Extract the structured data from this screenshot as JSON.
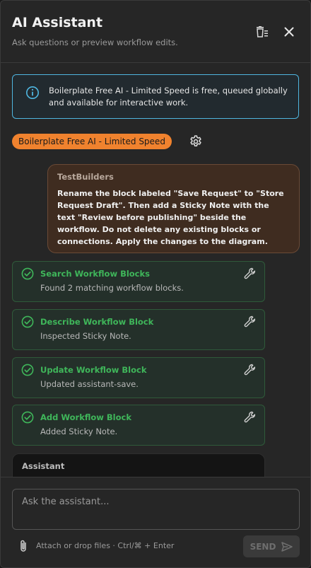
{
  "header": {
    "title": "AI Assistant",
    "subtitle": "Ask questions or preview workflow edits."
  },
  "info": {
    "text": "Boilerplate Free AI - Limited Speed is free, queued globally and available for interactive work."
  },
  "model": {
    "label": "Boilerplate Free AI - Limited Speed"
  },
  "user_message": {
    "author": "TestBuilders",
    "text": "Rename the block labeled \"Save Request\" to \"Store Request Draft\". Then add a Sticky Note with the text \"Review before publishing\" beside the workflow. Do not delete any existing blocks or connections. Apply the changes to the diagram."
  },
  "tools": [
    {
      "title": "Search Workflow Blocks",
      "desc": "Found 2 matching workflow blocks."
    },
    {
      "title": "Describe Workflow Block",
      "desc": "Inspected Sticky Note."
    },
    {
      "title": "Update Workflow Block",
      "desc": "Updated assistant-save."
    },
    {
      "title": "Add Workflow Block",
      "desc": "Added Sticky Note."
    }
  ],
  "assistant": {
    "label": "Assistant"
  },
  "composer": {
    "placeholder": "Ask the assistant...",
    "hint": "Attach or drop files · Ctrl/⌘ + Enter",
    "send_label": "SEND"
  },
  "colors": {
    "accent": "#f0822e",
    "info_border": "#4fb6e0",
    "success": "#3fb65a"
  },
  "icons": {
    "clear": "clear-chat-icon",
    "close": "close-icon",
    "info": "info-icon",
    "gear": "gear-icon",
    "check": "check-circle-icon",
    "wrench": "wrench-icon",
    "attach": "paperclip-icon",
    "send": "send-icon"
  }
}
